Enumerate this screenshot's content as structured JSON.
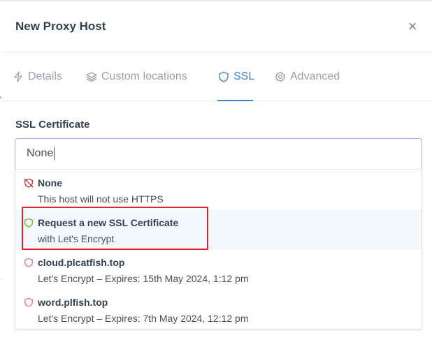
{
  "modal": {
    "title": "New Proxy Host",
    "close_glyph": "×"
  },
  "tabs": [
    {
      "label": "Details",
      "icon": "bolt-icon",
      "active": false
    },
    {
      "label": "Custom locations",
      "icon": "layers-icon",
      "active": false
    },
    {
      "label": "SSL",
      "icon": "shield-icon",
      "active": true
    },
    {
      "label": "Advanced",
      "icon": "gear-icon",
      "active": false
    }
  ],
  "ssl": {
    "field_label": "SSL Certificate",
    "selected_value": "None",
    "options": [
      {
        "title": "None",
        "subtitle": "This host will not use HTTPS",
        "icon": "shield-off-icon",
        "icon_color": "#cd201f"
      },
      {
        "title": "Request a new SSL Certificate",
        "subtitle": "with Let's Encrypt",
        "icon": "shield-icon",
        "icon_color": "#5eba00"
      },
      {
        "title": "cloud.plcatfish.top",
        "subtitle": "Let's Encrypt – Expires: 15th May 2024, 1:12 pm",
        "icon": "shield-icon",
        "icon_color": "#e26d8b"
      },
      {
        "title": "word.plfish.top",
        "subtitle": "Let's Encrypt – Expires: 7th May 2024, 12:12 pm",
        "icon": "shield-icon",
        "icon_color": "#e26d8b"
      }
    ]
  },
  "colors": {
    "accent": "#467fcf",
    "highlight_box": "#d7262e",
    "hover_row": "#f2f8fb"
  }
}
